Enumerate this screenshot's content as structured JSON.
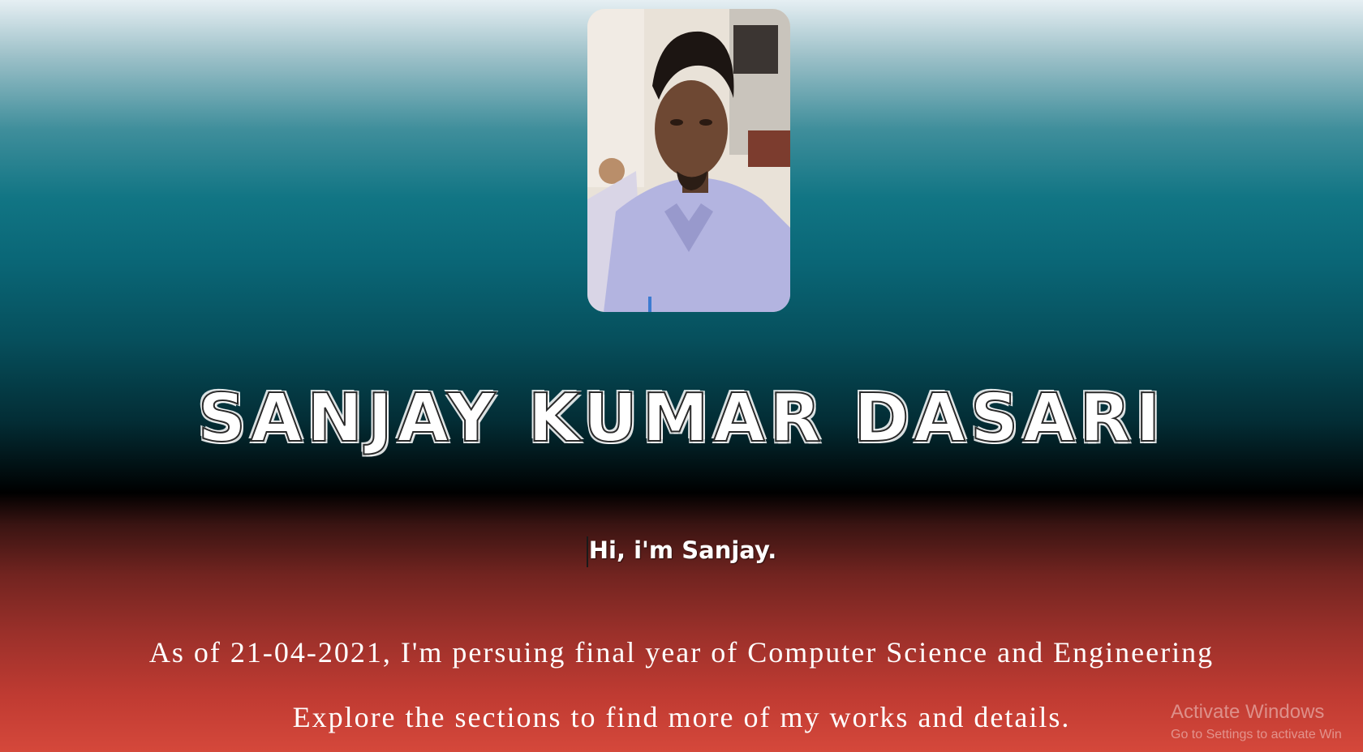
{
  "profile": {
    "photo_icon": "profile-photo",
    "name": "SANJAY KUMAR DASARI",
    "greeting": "Hi, i'm Sanjay.",
    "intro_line1": "As of 21-04-2021, I'm persuing final year of Computer Science and Engineering",
    "intro_line2": "Explore the sections to find more of my works and details."
  },
  "watermark": {
    "title": "Activate Windows",
    "subtitle": "Go to Settings to activate Win"
  },
  "colors": {
    "top": "#e6eff3",
    "teal": "#0a6777",
    "black": "#000000",
    "red": "#d5483b"
  }
}
